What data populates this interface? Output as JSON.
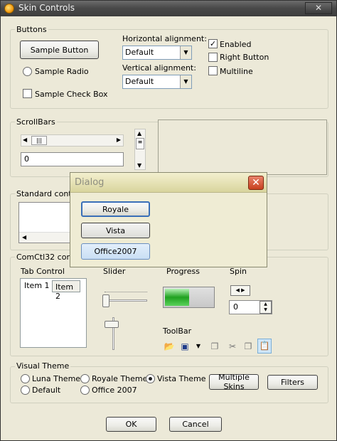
{
  "window": {
    "title": "Skin Controls",
    "close_glyph": "✕"
  },
  "buttons_group": {
    "label": "Buttons",
    "sample_button": "Sample Button",
    "sample_radio": "Sample Radio",
    "sample_checkbox": "Sample Check Box",
    "horizontal_alignment_label": "Horizontal alignment:",
    "horizontal_alignment_value": "Default",
    "vertical_alignment_label": "Vertical alignment:",
    "vertical_alignment_value": "Default",
    "enabled_label": "Enabled",
    "enabled_checked": true,
    "right_button_label": "Right Button",
    "multiline_label": "Multiline"
  },
  "scrollbars_group": {
    "label": "ScrollBars",
    "value": "0"
  },
  "standard_controls_group": {
    "label": "Standard controls"
  },
  "comctl_group": {
    "label": "ComCtl32 controls",
    "tab_control_label": "Tab Control",
    "tabs": [
      "Item 1",
      "Item 2"
    ],
    "slider_label": "Slider",
    "progress_label": "Progress",
    "spin_label": "Spin",
    "spin_value": "0",
    "toolbar_label": "ToolBar",
    "toolbar_icons": [
      "open-folder-icon",
      "save-disk-icon",
      "dropdown-arrow-icon",
      "copy-icon",
      "cut-icon",
      "copy2-icon",
      "paste-icon"
    ]
  },
  "visual_theme_group": {
    "label": "Visual Theme",
    "options": [
      "Luna Theme",
      "Royale Theme",
      "Vista Theme",
      "Default",
      "Office 2007"
    ],
    "selected": "Vista Theme",
    "multiple_skins_button": "Multiple Skins",
    "filters_button": "Filters"
  },
  "footer": {
    "ok": "OK",
    "cancel": "Cancel"
  },
  "dialog": {
    "title": "Dialog",
    "close_glyph": "✕",
    "buttons": [
      "Royale",
      "Vista",
      "Office2007"
    ]
  }
}
